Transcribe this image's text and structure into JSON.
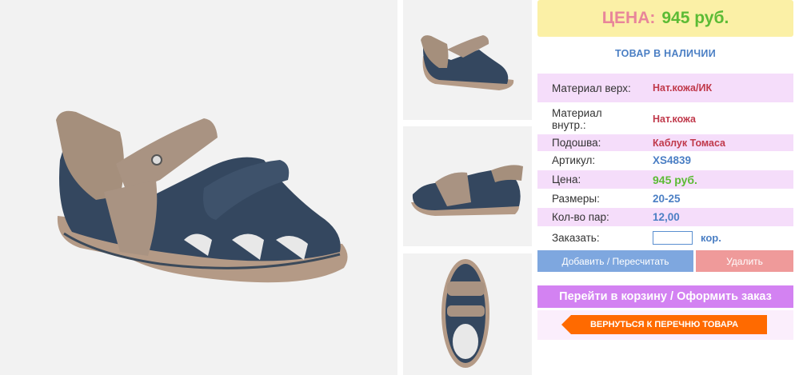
{
  "price": {
    "label": "ЦЕНА:",
    "value": "945 руб."
  },
  "stock_status": "ТОВАР В НАЛИЧИИ",
  "details": [
    {
      "label": "Материал верх:",
      "value": "Нат.кожа/ИК"
    },
    {
      "label": "Материал внутр.:",
      "value": "Нат.кожа"
    },
    {
      "label": "Подошва:",
      "value": "Каблук Томаса"
    },
    {
      "label": "Артикул:",
      "value": "XS4839"
    },
    {
      "label": "Цена:",
      "value": "945 руб."
    },
    {
      "label": "Размеры:",
      "value": "20-25"
    },
    {
      "label": "Кол-во пар:",
      "value": "12,00"
    }
  ],
  "order": {
    "label": "Заказать:",
    "value": "",
    "unit": "кор."
  },
  "buttons": {
    "add": "Добавить / Пересчитать",
    "delete": "Удалить",
    "cart": "Перейти в корзину / Оформить заказ",
    "back": "ВЕРНУТЬСЯ К ПЕРЕЧНЮ ТОВАРА"
  },
  "colors": {
    "price_bg": "#fbf0a6",
    "accent_blue": "#4b7fc4",
    "accent_green": "#5cbb35",
    "accent_red": "#c0394b",
    "row_pink": "#f5ddfa",
    "cart_purple": "#d382f2",
    "back_orange": "#ff6a00"
  }
}
